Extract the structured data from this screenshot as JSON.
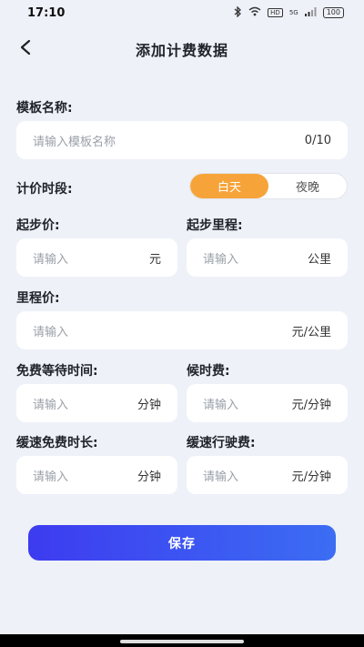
{
  "status": {
    "time": "17:10",
    "network": "HD",
    "signal": "5G",
    "battery": "100"
  },
  "nav": {
    "title": "添加计费数据",
    "back_icon": "chevron-left-icon"
  },
  "template": {
    "label": "模板名称:",
    "placeholder": "请输入模板名称",
    "counter": "0/10"
  },
  "period": {
    "label": "计价时段:",
    "options": [
      "白天",
      "夜晚"
    ],
    "selected": "白天"
  },
  "fields": {
    "start_price": {
      "label": "起步价:",
      "placeholder": "请输入",
      "unit": "元"
    },
    "start_distance": {
      "label": "起步里程:",
      "placeholder": "请输入",
      "unit": "公里"
    },
    "mileage_price": {
      "label": "里程价:",
      "placeholder": "请输入",
      "unit": "元/公里"
    },
    "free_wait": {
      "label": "免费等待时间:",
      "placeholder": "请输入",
      "unit": "分钟"
    },
    "wait_fee": {
      "label": "候时费:",
      "placeholder": "请输入",
      "unit": "元/分钟"
    },
    "slow_free": {
      "label": "缓速免费时长:",
      "placeholder": "请输入",
      "unit": "分钟"
    },
    "slow_fee": {
      "label": "缓速行驶费:",
      "placeholder": "请输入",
      "unit": "元/分钟"
    }
  },
  "actions": {
    "save_label": "保存"
  },
  "colors": {
    "accent": "#f6a43a",
    "primary": "#3d3bf0",
    "background": "#eef1f8"
  }
}
